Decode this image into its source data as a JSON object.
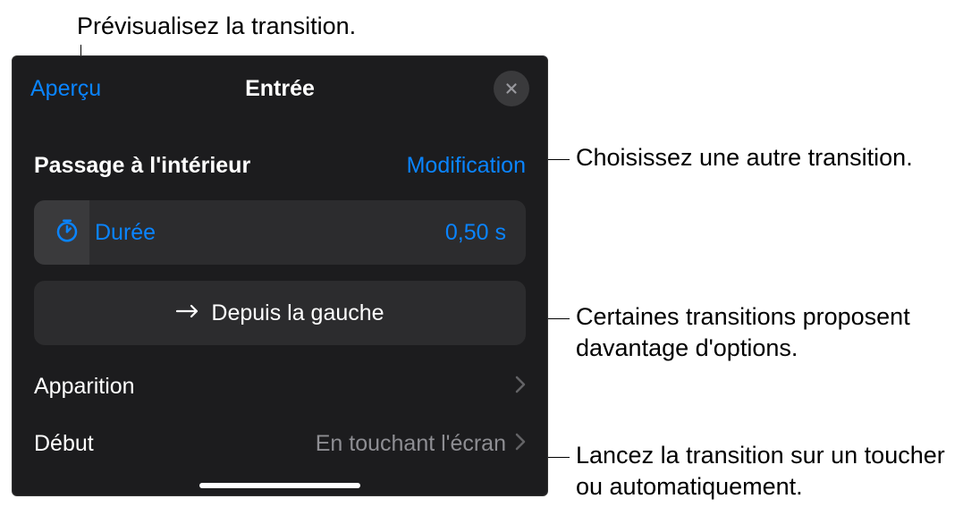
{
  "callouts": {
    "preview": "Prévisualisez la transition.",
    "modify": "Choisissez une autre transition.",
    "direction": "Certaines transitions proposent davantage d'options.",
    "start": "Lancez la transition sur un toucher ou automatiquement."
  },
  "header": {
    "preview": "Aperçu",
    "title": "Entrée"
  },
  "section": {
    "title": "Passage à l'intérieur",
    "modify": "Modification"
  },
  "duration": {
    "label": "Durée",
    "value": "0,50 s"
  },
  "direction": {
    "label": "Depuis la gauche"
  },
  "apparition": {
    "label": "Apparition"
  },
  "start": {
    "label": "Début",
    "value": "En touchant l'écran"
  }
}
